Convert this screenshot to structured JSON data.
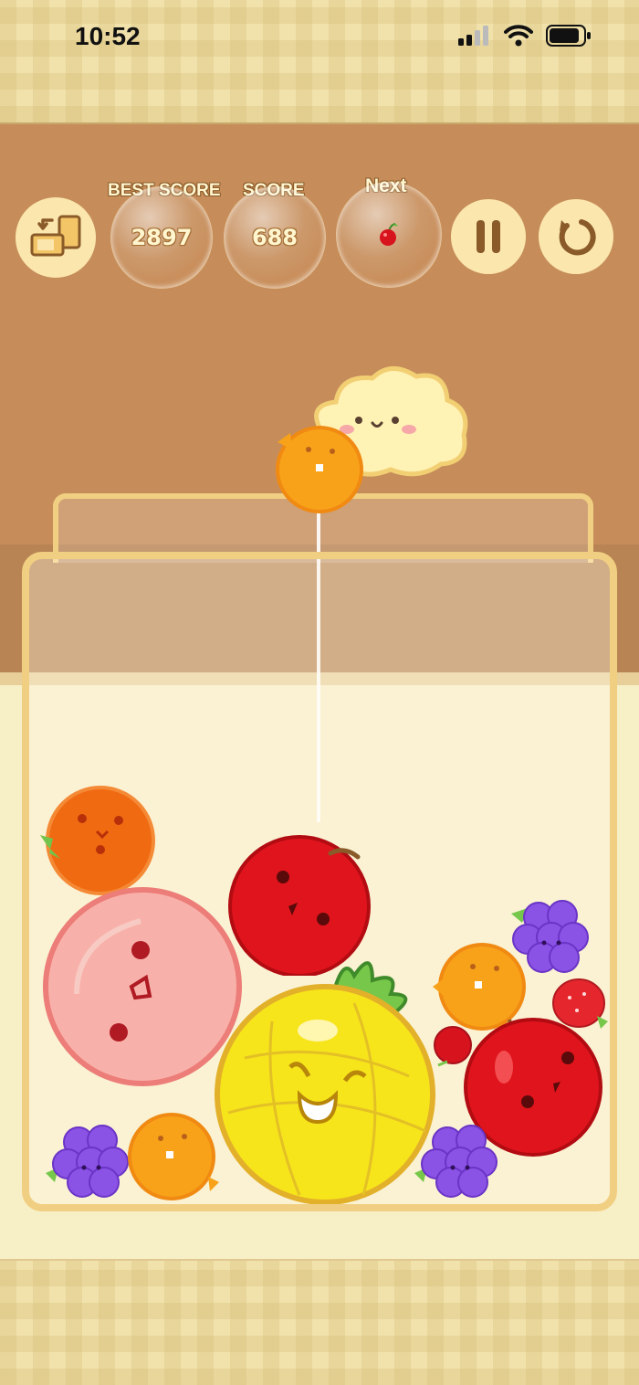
{
  "status_bar": {
    "time": "10:52"
  },
  "hud": {
    "best_score_label": "BEST SCORE",
    "best_score_value": "2897",
    "score_label": "SCORE",
    "score_value": "688",
    "next_label": "Next",
    "next_fruit_icon": "cherry-icon"
  },
  "colors": {
    "wall": "#c68d5a",
    "jar_frame": "#f1cf82",
    "button_bg": "#fbe7ad",
    "button_icon": "#8a5a28"
  },
  "game": {
    "current_drop_fruit": "orange",
    "fruits_in_jar": [
      "orange",
      "peach",
      "apple",
      "grape",
      "orange",
      "pineapple",
      "grape",
      "grape",
      "orange",
      "strawberry",
      "cherry",
      "apple"
    ]
  }
}
